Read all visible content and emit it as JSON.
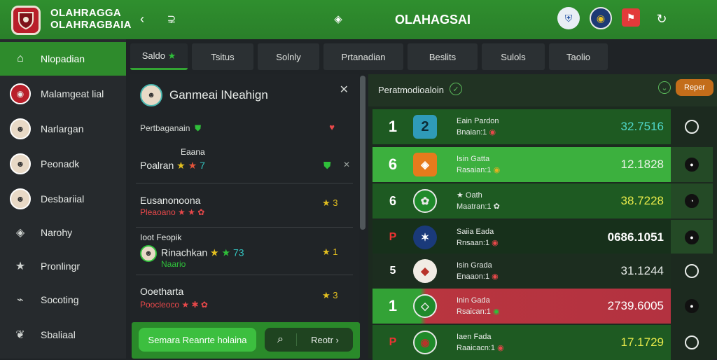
{
  "app": {
    "name_line1": "OLAHRAGGA",
    "name_line2": "OLAHRAGBAIA",
    "title": "OLAHAGSAI"
  },
  "icons": {
    "back": "chevron-left-icon",
    "chat": "chat-bubble-icon",
    "target": "target-icon",
    "refresh": "refresh-icon"
  },
  "sidebar": {
    "items": [
      {
        "label": "Nlopadian",
        "icon": "home-icon",
        "active": true
      },
      {
        "label": "Malamgeat lial",
        "icon": "club-crest-icon",
        "active": false
      },
      {
        "label": "Narlargan",
        "icon": "avatar-icon",
        "active": false
      },
      {
        "label": "Peonadk",
        "icon": "avatar-icon",
        "active": false
      },
      {
        "label": "Desbariial",
        "icon": "avatar-icon",
        "active": false
      },
      {
        "label": "Narohy",
        "icon": "eye-icon",
        "active": false
      },
      {
        "label": "Pronlingr",
        "icon": "star-icon",
        "active": false
      },
      {
        "label": "Socoting",
        "icon": "whistle-icon",
        "active": false
      },
      {
        "label": "Sbaliaal",
        "icon": "leaf-icon",
        "active": false
      }
    ]
  },
  "tabs": [
    {
      "label": "Saldo",
      "active": true
    },
    {
      "label": "Tsitus",
      "active": false
    },
    {
      "label": "Solnly",
      "active": false
    },
    {
      "label": "Prtanadian",
      "active": false
    },
    {
      "label": "Beslits",
      "active": false
    },
    {
      "label": "Sulols",
      "active": false
    },
    {
      "label": "Taolio",
      "active": false
    }
  ],
  "panel": {
    "title": "Ganmeai lNeahign",
    "subtitle": "Pertbaganain",
    "entries": [
      {
        "top": "Eaana",
        "name": "Poalran",
        "stars": "★ ★",
        "num": "7"
      },
      {
        "name": "Eusanonoona",
        "meta": "Pleaoano ★ ★ ✿",
        "side": "★ 3"
      },
      {
        "top": "Ioot Feopik",
        "name": "Rinachkan",
        "num": "73",
        "meta": "Naario",
        "side": "★ 1"
      },
      {
        "name": "Ooetharta",
        "meta": "Poocleoco ★ ✱ ✿",
        "side": "★ 3"
      }
    ]
  },
  "bottom": {
    "action": "Semara Reanrte holaina",
    "next": "Reotr"
  },
  "matches_header": {
    "title": "Peratmodioaloin",
    "report": "Reper"
  },
  "matches": [
    {
      "rank": "1",
      "crest": "2",
      "name": "Eain Pardon",
      "detail": "Bnaian:1",
      "score": "32.7516"
    },
    {
      "rank": "6",
      "crest": "◈",
      "name": "Isin Gatta",
      "detail": "Rasaian:1",
      "score": "12.1828"
    },
    {
      "rank": "6",
      "crest": "✿",
      "name": "★ Oath",
      "detail": "Maatran:1",
      "score": "38.7228"
    },
    {
      "rank": "P",
      "crest": "✶",
      "name": "Saiia Eada",
      "detail": "Rnsaan:1",
      "score": "0686.1051"
    },
    {
      "rank": "5",
      "crest": "◆",
      "name": "Isin Grada",
      "detail": "Enaaon:1",
      "score": "31.1244"
    },
    {
      "rank": "1",
      "crest": "◇",
      "name": "Inin Gada",
      "detail": "Rsaican:1",
      "score": "2739.6005"
    },
    {
      "rank": "P",
      "crest": "◉",
      "name": "Iaen Fada",
      "detail": "Raaicacn:1",
      "score": "17.1729"
    }
  ],
  "colors": {
    "primary": "#2e8b2c",
    "accent": "#3cbf3f",
    "danger": "#b9353f",
    "bg": "#1f2326"
  }
}
